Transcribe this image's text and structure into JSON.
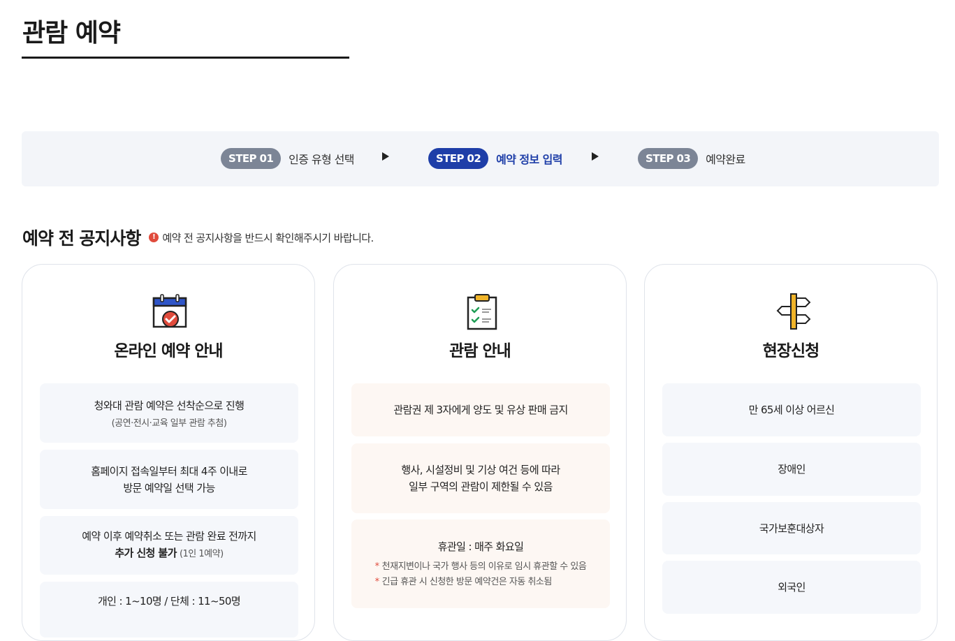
{
  "page": {
    "title": "관람 예약"
  },
  "steps": [
    {
      "badge": "STEP 01",
      "label": "인증 유형 선택",
      "active": false
    },
    {
      "badge": "STEP 02",
      "label": "예약 정보 입력",
      "active": true
    },
    {
      "badge": "STEP 03",
      "label": "예약완료",
      "active": false
    }
  ],
  "notice": {
    "title": "예약 전 공지사항",
    "icon": "alert-icon",
    "icon_glyph": "!",
    "text": "예약 전 공지사항을 반드시 확인해주시기 바랍니다."
  },
  "cards": {
    "online": {
      "icon": "calendar-check-icon",
      "title": "온라인 예약 안내",
      "items": [
        {
          "main": "청와대 관람 예약은 선착순으로 진행",
          "sub": "(공연·전시·교육 일부 관람 추첨)"
        },
        {
          "main": "홈페이지 접속일부터 최대 4주 이내로\n방문 예약일 선택 가능"
        },
        {
          "main_line1": "예약 이후 예약취소 또는 관람 완료 전까지",
          "main_bold": "추가 신청 불가",
          "main_small": "(1인 1예약)"
        },
        {
          "main": "개인 : 1~10명 / 단체 : 11~50명"
        }
      ]
    },
    "visit": {
      "icon": "clipboard-check-icon",
      "title": "관람 안내",
      "items": [
        {
          "main": "관람권 제 3자에게 양도 및 유상 판매 금지"
        },
        {
          "main": "행사, 시설정비 및 기상 여건 등에 따라\n일부 구역의 관람이 제한될 수 있음"
        },
        {
          "main": "휴관일 : 매주 화요일",
          "notes": [
            "천재지변이나 국가 행사 등의 이유로 임시 휴관할 수 있음",
            "긴급 휴관 시 신청한 방문 예약건은 자동 취소됨"
          ]
        }
      ]
    },
    "onsite": {
      "icon": "signpost-icon",
      "title": "현장신청",
      "items": [
        {
          "main": "만 65세 이상 어르신"
        },
        {
          "main": "장애인"
        },
        {
          "main": "국가보훈대상자"
        },
        {
          "main": "외국인"
        }
      ]
    }
  },
  "colors": {
    "accent": "#1e3ea8",
    "badge_inactive": "#7c8596",
    "alert": "#e04b3c"
  },
  "note_marker": "*"
}
